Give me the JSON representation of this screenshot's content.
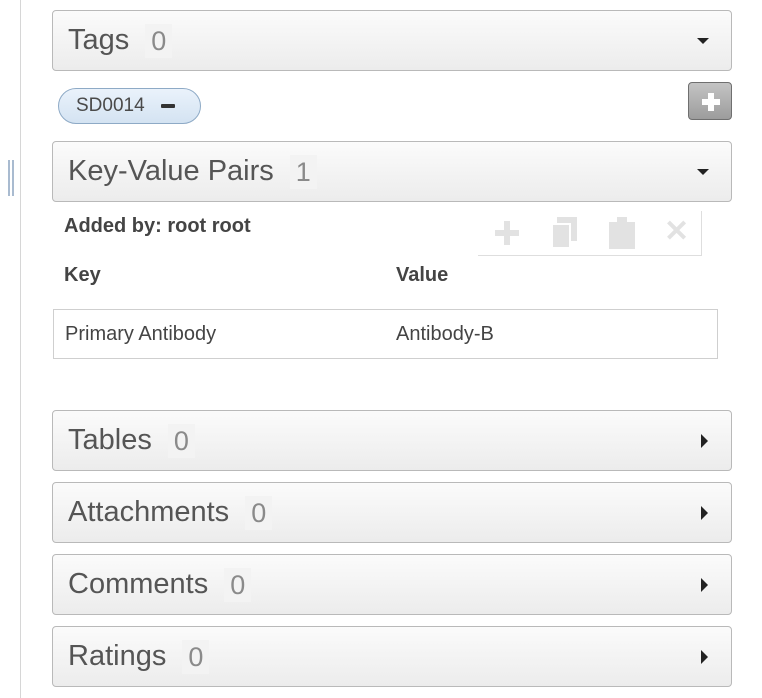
{
  "panels": {
    "tags": {
      "title": "Tags",
      "count": "0"
    },
    "kvp": {
      "title": "Key-Value Pairs",
      "count": "1"
    },
    "tables": {
      "title": "Tables",
      "count": "0"
    },
    "attachments": {
      "title": "Attachments",
      "count": "0"
    },
    "comments": {
      "title": "Comments",
      "count": "0"
    },
    "ratings": {
      "title": "Ratings",
      "count": "0"
    }
  },
  "tags": {
    "items": [
      {
        "label": "SD0014"
      }
    ],
    "add_button_icon": "plus-icon",
    "remove_icon": "minus-icon"
  },
  "kvp": {
    "added_by": "Added by: root root",
    "columns": {
      "key": "Key",
      "value": "Value"
    },
    "rows": [
      {
        "key": "Primary Antibody",
        "value": "Antibody-B"
      }
    ],
    "toolbar_icons": [
      "plus-icon",
      "copy-icon",
      "paste-icon",
      "delete-icon"
    ],
    "delete_glyph": "✕"
  },
  "colors": {
    "tag_fill": "#d4e3f2",
    "tag_border": "#8eaac6",
    "header_border": "#b9b9b9",
    "toolbar_disabled": "#e2e2e2"
  }
}
